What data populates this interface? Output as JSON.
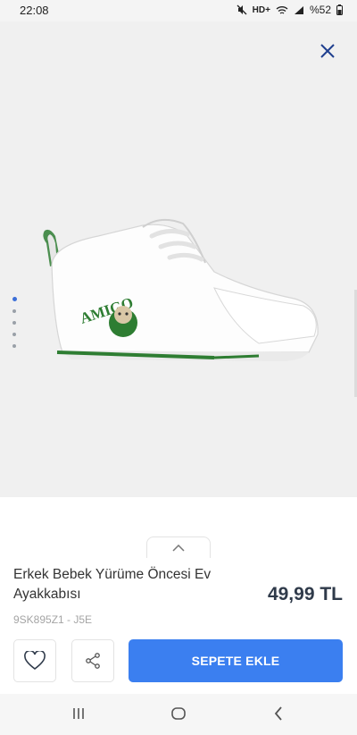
{
  "status_bar": {
    "time": "22:08",
    "network": "HD+",
    "battery": "%52",
    "icons": [
      "mute-icon",
      "wifi-icon",
      "signal-icon",
      "battery-icon"
    ]
  },
  "gallery": {
    "image_count": 5,
    "active_index": 0,
    "shoe_brand_text": "AMIGO"
  },
  "product": {
    "title": "Erkek Bebek Yürüme Öncesi Ev Ayakkabısı",
    "price": "49,99 TL",
    "sku": "9SK895Z1 - J5E"
  },
  "actions": {
    "add_to_cart_label": "SEPETE EKLE"
  },
  "colors": {
    "accent": "#3b7ff0",
    "close": "#1f3f8f",
    "price": "#2f3a4a",
    "shoe_green": "#2e7d32"
  }
}
